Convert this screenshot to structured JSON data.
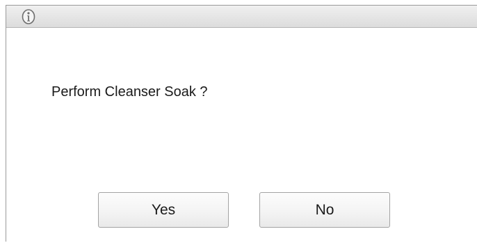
{
  "dialog": {
    "icon": "info-icon",
    "message": "Perform Cleanser Soak ?",
    "buttons": {
      "yes_label": "Yes",
      "no_label": "No"
    }
  }
}
